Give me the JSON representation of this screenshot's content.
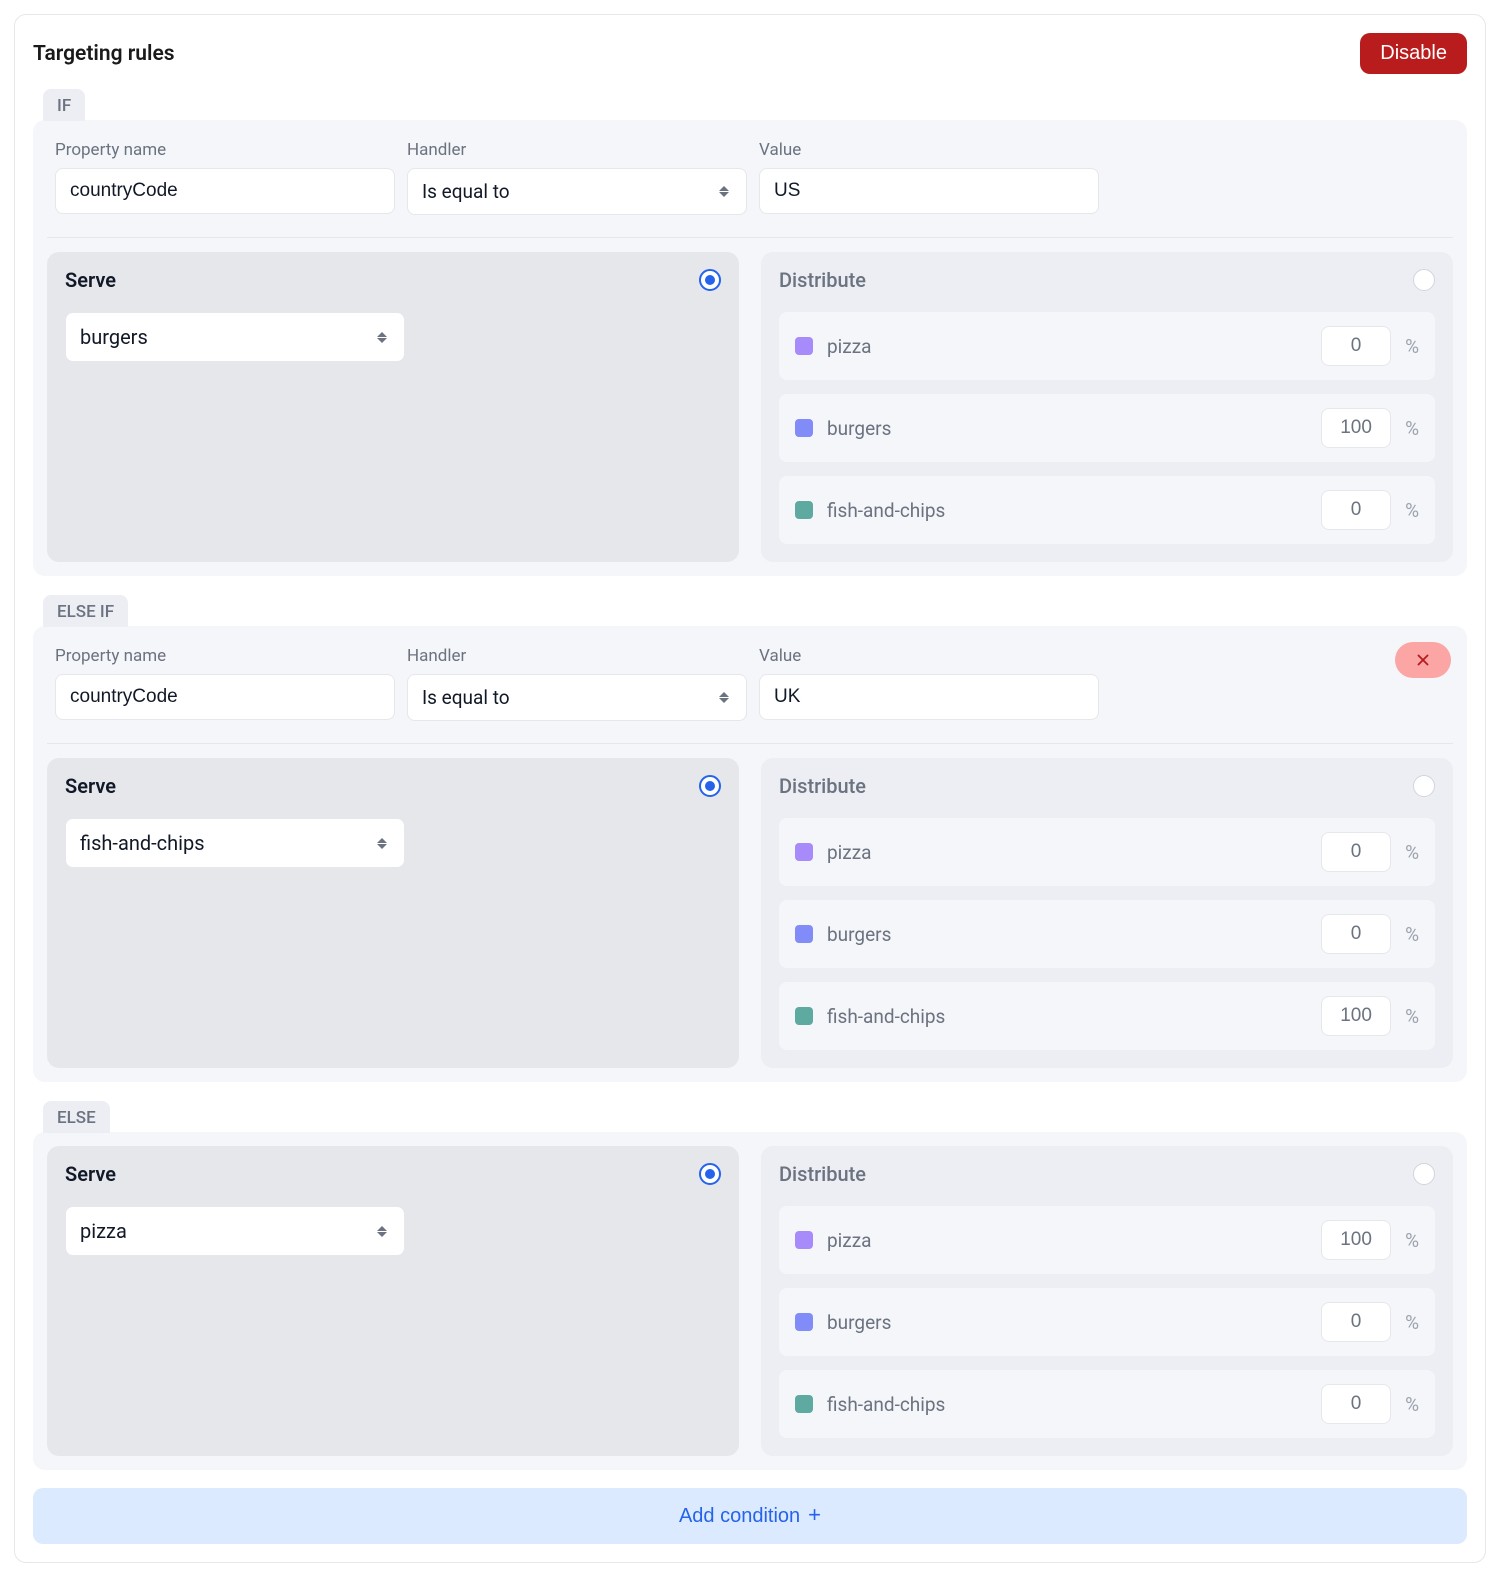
{
  "header": {
    "title": "Targeting rules",
    "disable_label": "Disable"
  },
  "labels": {
    "property": "Property name",
    "handler": "Handler",
    "value": "Value",
    "serve": "Serve",
    "distribute": "Distribute",
    "percent": "%"
  },
  "variants": [
    {
      "key": "pizza",
      "swatch": "sw-purple"
    },
    {
      "key": "burgers",
      "swatch": "sw-indigo"
    },
    {
      "key": "fish-and-chips",
      "swatch": "sw-teal"
    }
  ],
  "rules": [
    {
      "tab": "IF",
      "removable": false,
      "condition": {
        "property": "countryCode",
        "handler": "Is equal to",
        "value": "US"
      },
      "mode": "serve",
      "serve_value": "burgers",
      "distribution": {
        "pizza": "0",
        "burgers": "100",
        "fish-and-chips": "0"
      }
    },
    {
      "tab": "ELSE IF",
      "removable": true,
      "condition": {
        "property": "countryCode",
        "handler": "Is equal to",
        "value": "UK"
      },
      "mode": "serve",
      "serve_value": "fish-and-chips",
      "distribution": {
        "pizza": "0",
        "burgers": "0",
        "fish-and-chips": "100"
      }
    },
    {
      "tab": "ELSE",
      "removable": false,
      "condition": null,
      "mode": "serve",
      "serve_value": "pizza",
      "distribution": {
        "pizza": "100",
        "burgers": "0",
        "fish-and-chips": "0"
      }
    }
  ],
  "add_condition_label": "Add condition"
}
